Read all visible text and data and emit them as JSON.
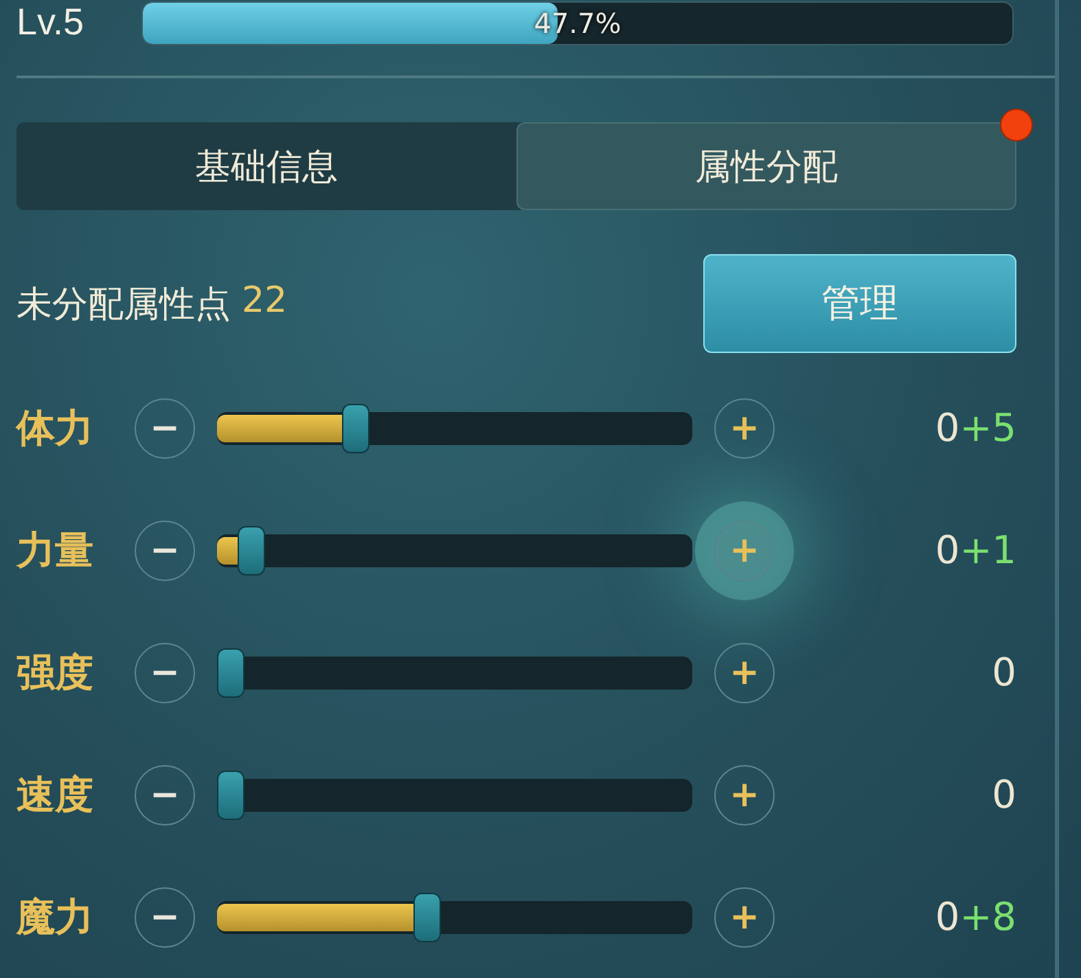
{
  "header": {
    "level_label": "Lv.5",
    "exp": {
      "level": 0.477,
      "reading": "47.7%"
    }
  },
  "tabs": [
    {
      "label": "基础信息",
      "selected": false,
      "badge": false
    },
    {
      "label": "属性分配",
      "selected": true,
      "badge": true
    }
  ],
  "points": {
    "label": "未分配属性点",
    "value": "22"
  },
  "manage_button": {
    "label": "管理"
  },
  "attributes": [
    {
      "name": "体力",
      "minus": "−",
      "plus": "+",
      "level": 0.29,
      "base": "0",
      "bonus": "+5",
      "highlighted": false
    },
    {
      "name": "力量",
      "minus": "−",
      "plus": "+",
      "level": 0.07,
      "base": "0",
      "bonus": "+1",
      "highlighted": true
    },
    {
      "name": "强度",
      "minus": "−",
      "plus": "+",
      "level": 0,
      "base": "0",
      "highlighted": false
    },
    {
      "name": "速度",
      "minus": "−",
      "plus": "+",
      "level": 0,
      "base": "0",
      "highlighted": false
    },
    {
      "name": "魔力",
      "minus": "−",
      "plus": "+",
      "level": 0.44,
      "base": "0",
      "bonus": "+8",
      "highlighted": false
    }
  ]
}
